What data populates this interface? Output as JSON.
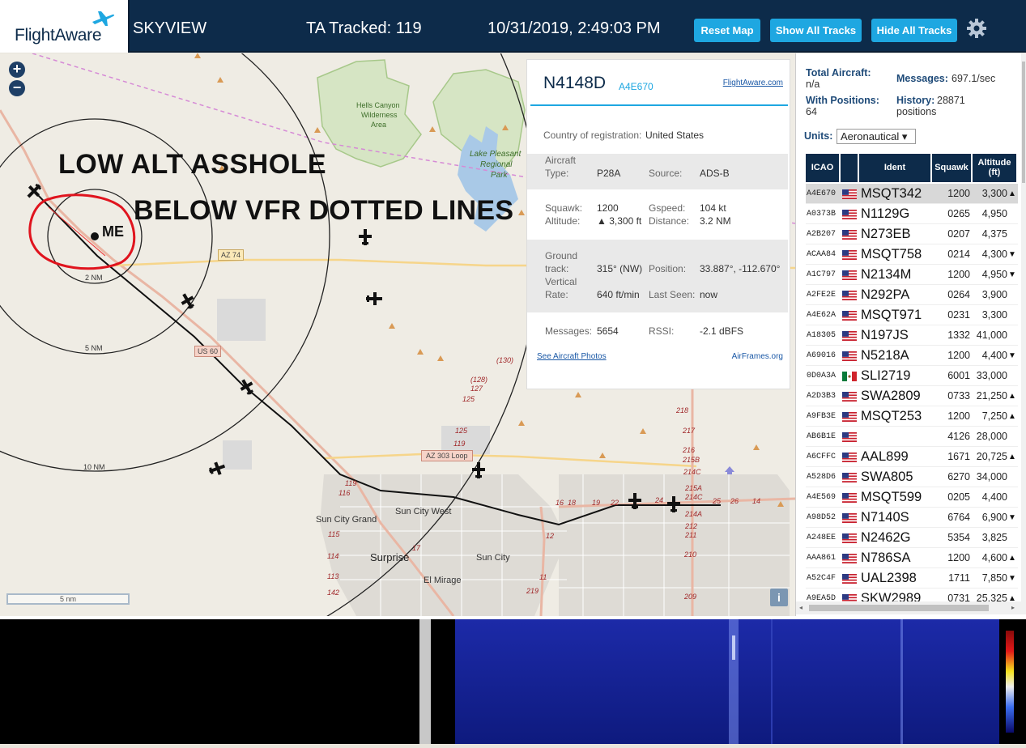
{
  "header": {
    "logo_text": "FlightAware",
    "app_name": "SKYVIEW",
    "tracked": "TA Tracked: 119",
    "datetime": "10/31/2019, 2:49:03 PM",
    "btn_reset": "Reset Map",
    "btn_show": "Show All Tracks",
    "btn_hide": "Hide All Tracks"
  },
  "map": {
    "zoom_in": "+",
    "zoom_out": "−",
    "scale_label": "5 nm",
    "info": "i",
    "annotation_line1": "LOW ALT ASSHOLE",
    "annotation_line2": "BELOW VFR DOTTED LINES",
    "annotation_me": "ME",
    "ring_labels": [
      "2 NM",
      "5 NM",
      "10 NM"
    ],
    "place_labels": {
      "hells_canyon": "Hells Canyon",
      "wilderness": "Wilderness",
      "area": "Area",
      "lake_pleasant": "Lake Pleasant",
      "regional": "Regional",
      "park": "Park",
      "sun_city_grand": "Sun City Grand",
      "sun_city_west": "Sun City West",
      "surprise": "Surprise",
      "sun_city": "Sun City",
      "el_mirage": "El Mirage"
    },
    "road_labels": {
      "az74": "AZ 74",
      "us60": "US 60",
      "az303": "AZ 303 Loop"
    },
    "exit_numbers": [
      "(130)",
      "(128)",
      "127",
      "125",
      "125",
      "119",
      "119",
      "116",
      "115",
      "114",
      "113",
      "142",
      "17",
      "16",
      "18",
      "19",
      "22",
      "24",
      "25",
      "26",
      "14",
      "12",
      "11",
      "219",
      "218",
      "217",
      "216",
      "215B",
      "214C",
      "215A",
      "214C",
      "214A",
      "212",
      "211",
      "210",
      "209"
    ]
  },
  "popup": {
    "callsign": "N4148D",
    "hex": "A4E670",
    "fa_link": "FlightAware.com",
    "country_label": "Country of registration:",
    "country": "United States",
    "aircraft_type_label_1": "Aircraft",
    "aircraft_type_label_2": "Type:",
    "aircraft_type": "P28A",
    "source_label": "Source:",
    "source": "ADS-B",
    "squawk_label": "Squawk:",
    "squawk": "1200",
    "gspeed_label": "Gspeed:",
    "gspeed": "104 kt",
    "altitude_label": "Altitude:",
    "altitude": "▲ 3,300 ft",
    "distance_label": "Distance:",
    "distance": "3.2 NM",
    "track_label_1": "Ground",
    "track_label_2": "track:",
    "track": "315° (NW)",
    "position_label": "Position:",
    "position": "33.887°, -112.670°",
    "vrate_label_1": "Vertical",
    "vrate_label_2": "Rate:",
    "vrate": "640 ft/min",
    "last_seen_label": "Last Seen:",
    "last_seen": "now",
    "messages_label": "Messages:",
    "messages": "5654",
    "rssi_label": "RSSI:",
    "rssi": "-2.1 dBFS",
    "photos_link": "See Aircraft Photos",
    "airframes_link": "AirFrames.org"
  },
  "side": {
    "total_label": "Total Aircraft:",
    "total_value": "n/a",
    "messages_label": "Messages:",
    "messages_value": "697.1/sec",
    "positions_label": "With Positions:",
    "positions_value": "64",
    "history_label": "History:",
    "history_value": "28871",
    "history_unit": "positions",
    "units_label": "Units:",
    "units_value": "Aeronautical ▾",
    "columns": {
      "icao": "ICAO",
      "ident": "Ident",
      "squawk": "Squawk",
      "alt1": "Altitude",
      "alt2": "(ft)"
    },
    "rows": [
      {
        "icao": "A4E670",
        "flag": "us",
        "ident": "MSQT342",
        "squawk": "1200",
        "alt": "3,300",
        "trend": "▲",
        "sel": true
      },
      {
        "icao": "A0373B",
        "flag": "us",
        "ident": "N1129G",
        "squawk": "0265",
        "alt": "4,950",
        "trend": ""
      },
      {
        "icao": "A2B207",
        "flag": "us",
        "ident": "N273EB",
        "squawk": "0207",
        "alt": "4,375",
        "trend": ""
      },
      {
        "icao": "ACAA84",
        "flag": "us",
        "ident": "MSQT758",
        "squawk": "0214",
        "alt": "4,300",
        "trend": "▼"
      },
      {
        "icao": "A1C797",
        "flag": "us",
        "ident": "N2134M",
        "squawk": "1200",
        "alt": "4,950",
        "trend": "▼"
      },
      {
        "icao": "A2FE2E",
        "flag": "us",
        "ident": "N292PA",
        "squawk": "0264",
        "alt": "3,900",
        "trend": ""
      },
      {
        "icao": "A4E62A",
        "flag": "us",
        "ident": "MSQT971",
        "squawk": "0231",
        "alt": "3,300",
        "trend": ""
      },
      {
        "icao": "A18305",
        "flag": "us",
        "ident": "N197JS",
        "squawk": "1332",
        "alt": "41,000",
        "trend": ""
      },
      {
        "icao": "A69016",
        "flag": "us",
        "ident": "N5218A",
        "squawk": "1200",
        "alt": "4,400",
        "trend": "▼"
      },
      {
        "icao": "0D0A3A",
        "flag": "mx",
        "ident": "SLI2719",
        "squawk": "6001",
        "alt": "33,000",
        "trend": ""
      },
      {
        "icao": "A2D3B3",
        "flag": "us",
        "ident": "SWA2809",
        "squawk": "0733",
        "alt": "21,250",
        "trend": "▲"
      },
      {
        "icao": "A9FB3E",
        "flag": "us",
        "ident": "MSQT253",
        "squawk": "1200",
        "alt": "7,250",
        "trend": "▲"
      },
      {
        "icao": "AB6B1E",
        "flag": "us",
        "ident": "",
        "squawk": "4126",
        "alt": "28,000",
        "trend": ""
      },
      {
        "icao": "A6CFFC",
        "flag": "us",
        "ident": "AAL899",
        "squawk": "1671",
        "alt": "20,725",
        "trend": "▲"
      },
      {
        "icao": "A528D6",
        "flag": "us",
        "ident": "SWA805",
        "squawk": "6270",
        "alt": "34,000",
        "trend": ""
      },
      {
        "icao": "A4E569",
        "flag": "us",
        "ident": "MSQT599",
        "squawk": "0205",
        "alt": "4,400",
        "trend": ""
      },
      {
        "icao": "A98D52",
        "flag": "us",
        "ident": "N7140S",
        "squawk": "6764",
        "alt": "6,900",
        "trend": "▼"
      },
      {
        "icao": "A248EE",
        "flag": "us",
        "ident": "N2462G",
        "squawk": "5354",
        "alt": "3,825",
        "trend": ""
      },
      {
        "icao": "AAA861",
        "flag": "us",
        "ident": "N786SA",
        "squawk": "1200",
        "alt": "4,600",
        "trend": "▲"
      },
      {
        "icao": "A52C4F",
        "flag": "us",
        "ident": "UAL2398",
        "squawk": "1711",
        "alt": "7,850",
        "trend": "▼"
      },
      {
        "icao": "A9EA5D",
        "flag": "us",
        "ident": "SKW2989",
        "squawk": "0731",
        "alt": "25,325",
        "trend": "▲"
      }
    ]
  },
  "colors": {
    "header_bg": "#0d2b4a",
    "accent": "#1ea7e1",
    "annotation_red": "#e0141e"
  }
}
